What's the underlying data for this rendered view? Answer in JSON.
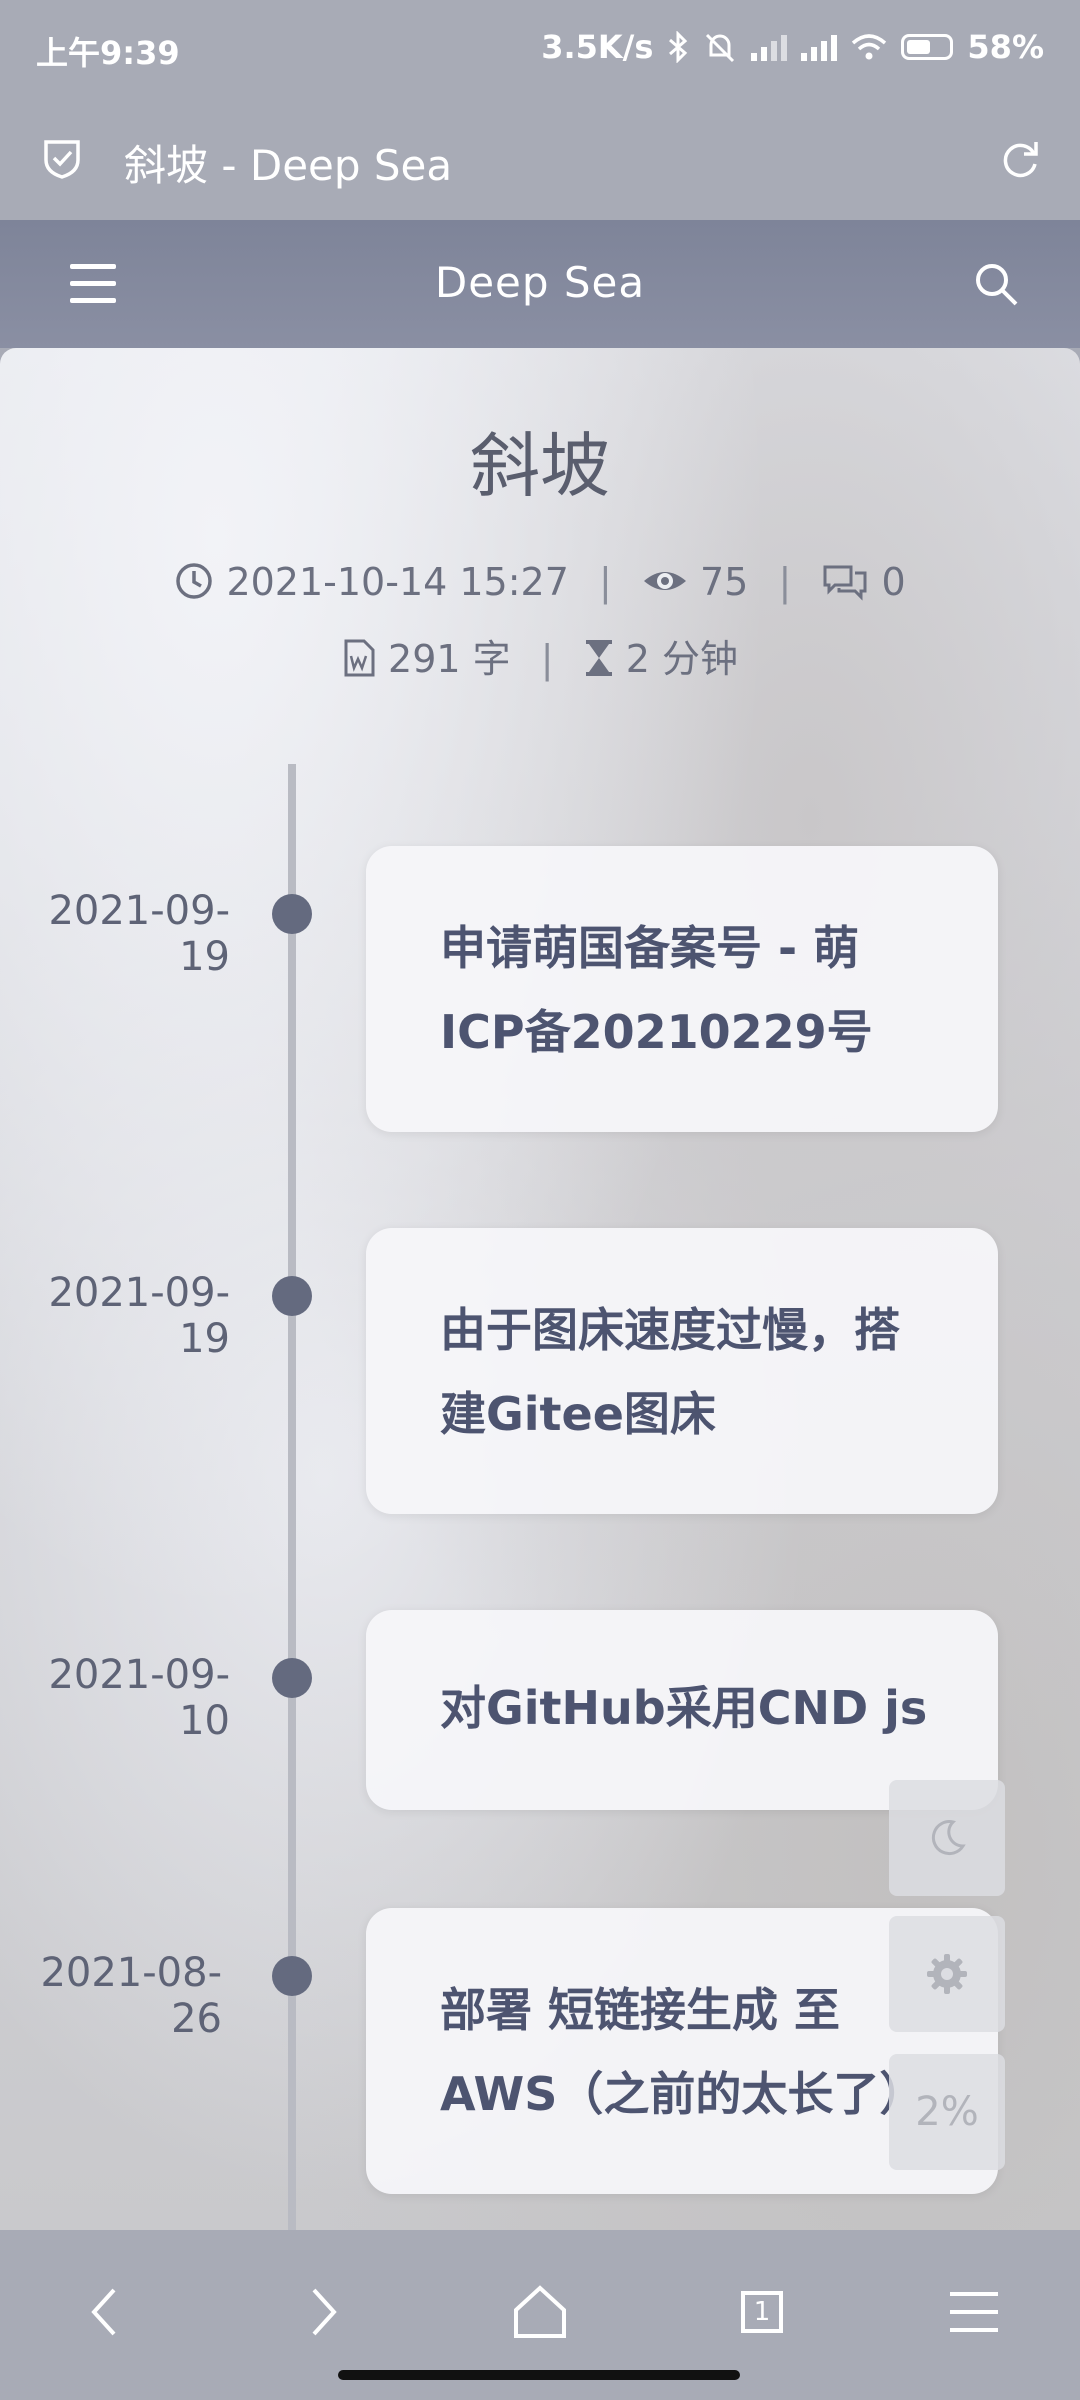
{
  "status": {
    "time": "上午9:39",
    "net_speed": "3.5K/s",
    "battery": "58%",
    "battery_level": 0.58
  },
  "browser": {
    "page_title": "斜坡 - Deep Sea"
  },
  "site": {
    "name": "Deep Sea"
  },
  "post": {
    "title": "斜坡",
    "date": "2021-10-14 15:27",
    "views": "75",
    "comments": "0",
    "words": "291 字",
    "read_time": "2 分钟"
  },
  "timeline": [
    {
      "date": "2021-09-19",
      "lines": [
        "申请萌国备案号 - 萌",
        "ICP备20210229号"
      ]
    },
    {
      "date": "2021-09-19",
      "lines": [
        "由于图床速度过慢，搭",
        "建Gitee图床"
      ]
    },
    {
      "date": "2021-09-10",
      "lines": [
        "对GitHub采用CND js"
      ]
    },
    {
      "date": "2021-08-26",
      "lines": [
        "部署 短链接生成 至",
        "AWS（之前的太长了）"
      ]
    }
  ],
  "floating": {
    "scroll_percent": "2%"
  },
  "icons": {
    "shield": "shield-check-icon",
    "reload": "reload-icon",
    "menu": "hamburger-menu-icon",
    "search": "search-icon",
    "clock": "clock-icon",
    "eye": "eye-icon",
    "comments": "comments-icon",
    "word_doc": "word-document-icon",
    "hourglass": "hourglass-icon",
    "moon": "moon-icon",
    "gear": "gear-icon",
    "back": "back-arrow-icon",
    "forward": "forward-arrow-icon",
    "home": "home-icon",
    "tabs": "tabs-icon",
    "browser_menu": "browser-menu-icon"
  },
  "tabs_count": "1"
}
